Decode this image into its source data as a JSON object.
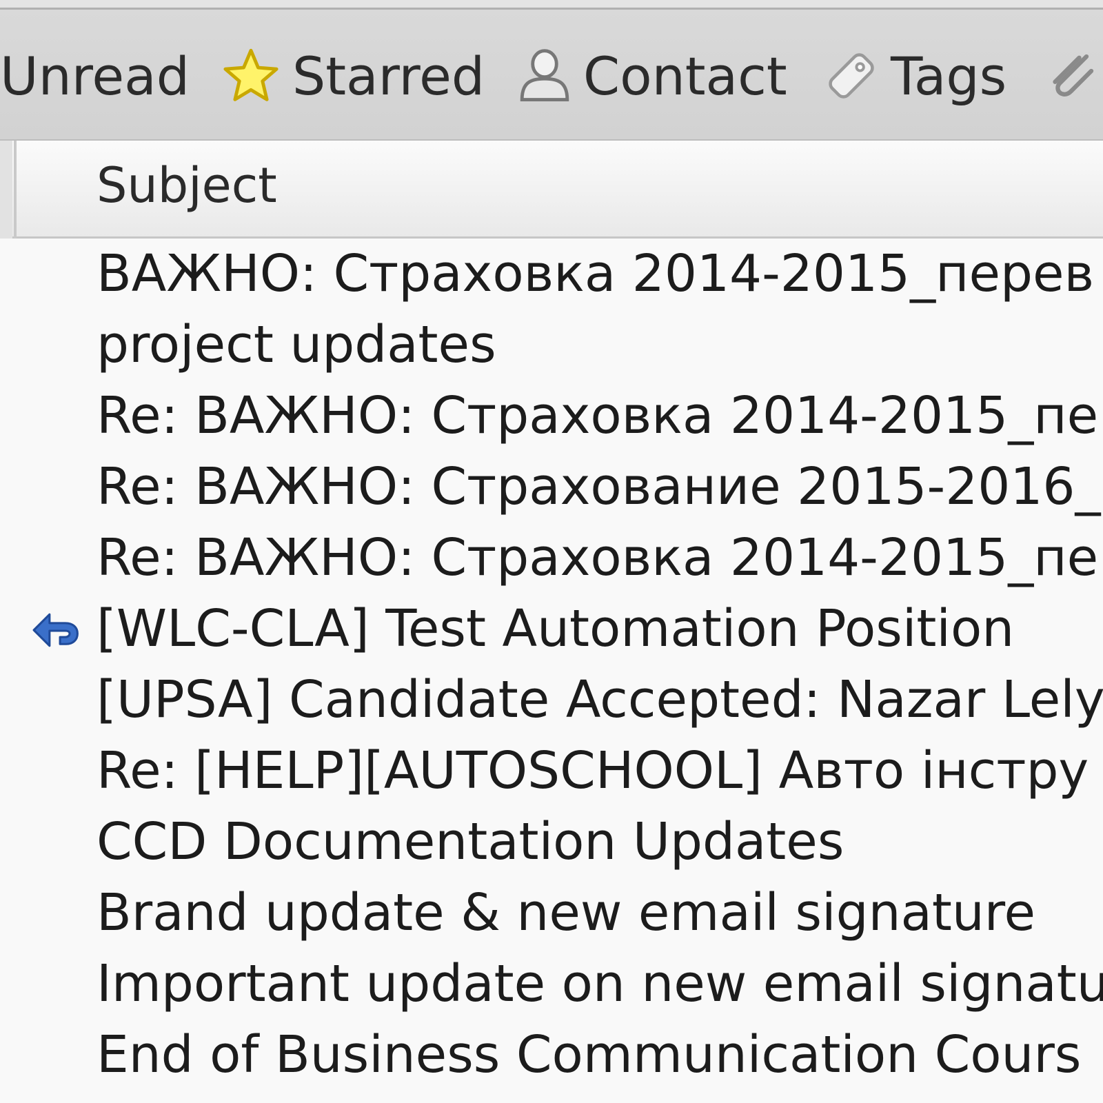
{
  "toolbar": {
    "unread_label": "Unread",
    "starred_label": "Starred",
    "contact_label": "Contact",
    "tags_label": "Tags",
    "icons": {
      "starred": "star-icon",
      "contact": "person-icon",
      "tags": "tag-icon",
      "attachment": "paperclip-icon"
    }
  },
  "columns": {
    "subject": "Subject"
  },
  "messages": [
    {
      "subject": "ВАЖНО: Страховка 2014-2015_перев",
      "replied": false
    },
    {
      "subject": "project updates",
      "replied": false
    },
    {
      "subject": "Re: ВАЖНО: Страховка 2014-2015_пе",
      "replied": false
    },
    {
      "subject": "Re: ВАЖНО: Страхование 2015-2016_",
      "replied": false
    },
    {
      "subject": "Re: ВАЖНО: Страховка 2014-2015_пе",
      "replied": false
    },
    {
      "subject": "[WLC-CLA] Test Automation Position",
      "replied": true
    },
    {
      "subject": "[UPSA] Candidate Accepted: Nazar Lely",
      "replied": false
    },
    {
      "subject": "Re: [HELP][AUTOSCHOOL] Авто інстру",
      "replied": false
    },
    {
      "subject": "CCD Documentation Updates",
      "replied": false
    },
    {
      "subject": "Brand update & new email signature",
      "replied": false
    },
    {
      "subject": "Important update on new email signatu",
      "replied": false
    },
    {
      "subject": "End of Business Communication Cours",
      "replied": false
    }
  ],
  "colors": {
    "toolbar_bg": "#d6d6d6",
    "header_bg": "#f0f0f0",
    "list_bg": "#f9f9f9",
    "star": "#f5d800",
    "replied_arrow": "#2f5fb3"
  }
}
